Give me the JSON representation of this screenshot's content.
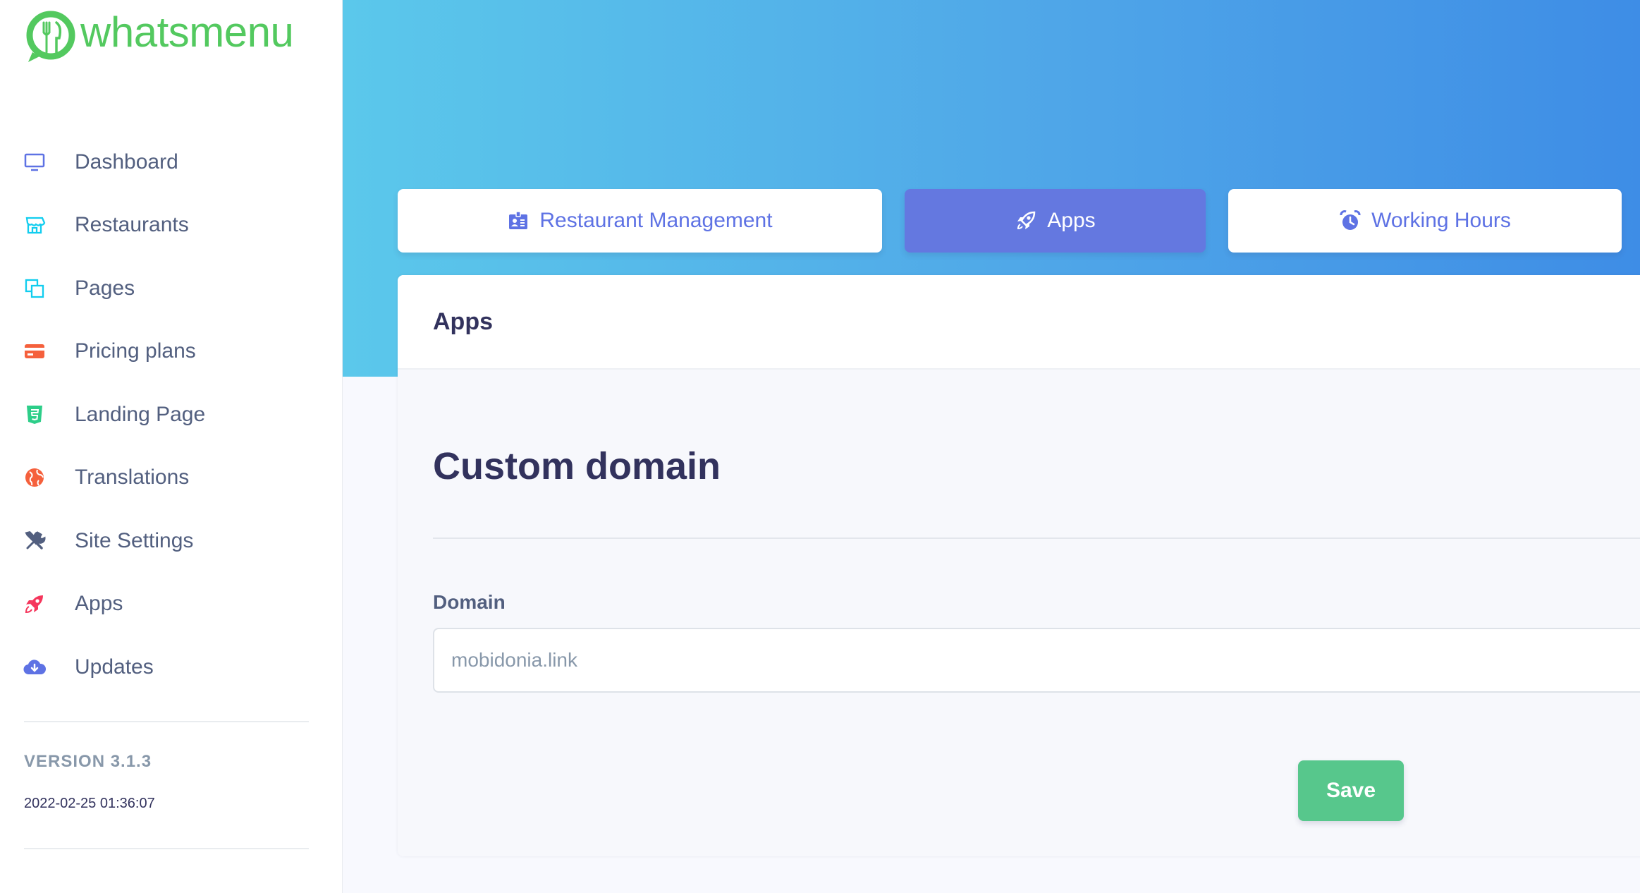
{
  "brand": {
    "name": "whatsmenu",
    "color": "#53c95f"
  },
  "sidebar": {
    "items": [
      {
        "label": "Dashboard",
        "icon": "monitor-icon",
        "color": "#5e72e4"
      },
      {
        "label": "Restaurants",
        "icon": "shop-icon",
        "color": "#11cdef"
      },
      {
        "label": "Pages",
        "icon": "pages-icon",
        "color": "#11cdef"
      },
      {
        "label": "Pricing plans",
        "icon": "credit-card-icon",
        "color": "#f5603c"
      },
      {
        "label": "Landing Page",
        "icon": "html5-icon",
        "color": "#2dce89"
      },
      {
        "label": "Translations",
        "icon": "globe-icon",
        "color": "#f5603c"
      },
      {
        "label": "Site Settings",
        "icon": "tools-icon",
        "color": "#525f7f"
      },
      {
        "label": "Apps",
        "icon": "rocket-icon",
        "color": "#f5365c"
      },
      {
        "label": "Updates",
        "icon": "cloud-download-icon",
        "color": "#5e72e4"
      }
    ],
    "version": "VERSION 3.1.3",
    "timestamp": "2022-02-25 01:36:07"
  },
  "tabs": [
    {
      "label": "Restaurant Management",
      "icon": "id-badge-icon",
      "active": false
    },
    {
      "label": "Apps",
      "icon": "rocket-icon",
      "active": true
    },
    {
      "label": "Working Hours",
      "icon": "alarm-clock-icon",
      "active": false
    }
  ],
  "card": {
    "title": "Apps",
    "section_title": "Custom domain",
    "domain_label": "Domain",
    "domain_value": "mobidonia.link",
    "save_label": "Save"
  },
  "colors": {
    "header_gradient_start": "#5bc8eb",
    "header_gradient_end": "#3e8de6",
    "active_tab": "#6478e0",
    "save_button": "#57c78c"
  }
}
